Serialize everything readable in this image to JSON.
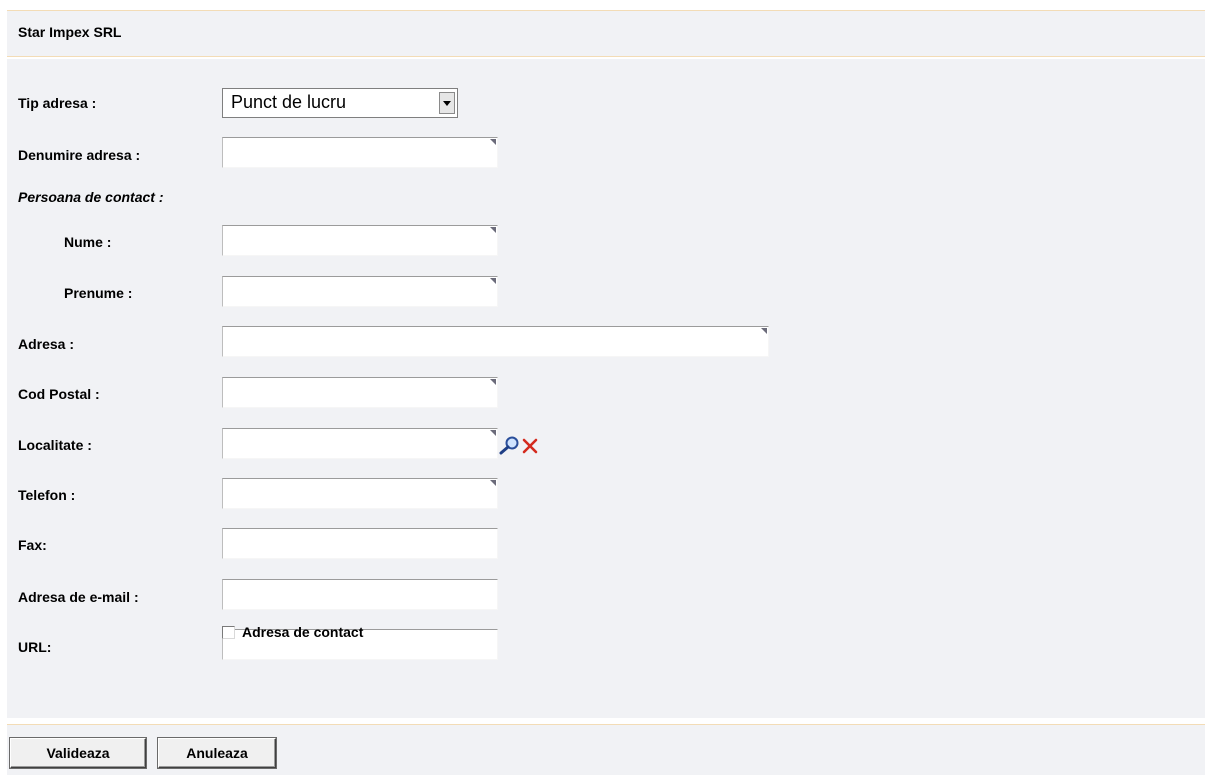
{
  "header": {
    "company_name": "Star Impex SRL"
  },
  "form": {
    "tip_adresa": {
      "label": "Tip adresa :",
      "selected": "Punct de lucru"
    },
    "denumire_adresa": {
      "label": "Denumire adresa :",
      "value": ""
    },
    "persoana_contact_label": "Persoana de contact :",
    "nume": {
      "label": "Nume :",
      "value": ""
    },
    "prenume": {
      "label": "Prenume :",
      "value": ""
    },
    "adresa": {
      "label": "Adresa :",
      "value": ""
    },
    "cod_postal": {
      "label": "Cod Postal :",
      "value": ""
    },
    "localitate": {
      "label": "Localitate :",
      "value": ""
    },
    "telefon": {
      "label": "Telefon :",
      "value": ""
    },
    "fax": {
      "label": "Fax:",
      "value": ""
    },
    "email": {
      "label": "Adresa de e-mail :",
      "value": ""
    },
    "url": {
      "label": "URL:",
      "value": ""
    },
    "adresa_contact_checkbox": {
      "label": "Adresa de contact",
      "checked": false
    }
  },
  "footer": {
    "validate_label": "Valideaza",
    "cancel_label": "Anuleaza"
  },
  "colors": {
    "panel_background": "#f1f2f5",
    "separator": "#f3dcb6",
    "clear_icon": "#d42a1e",
    "lookup_icon": "#2a4e9a"
  }
}
